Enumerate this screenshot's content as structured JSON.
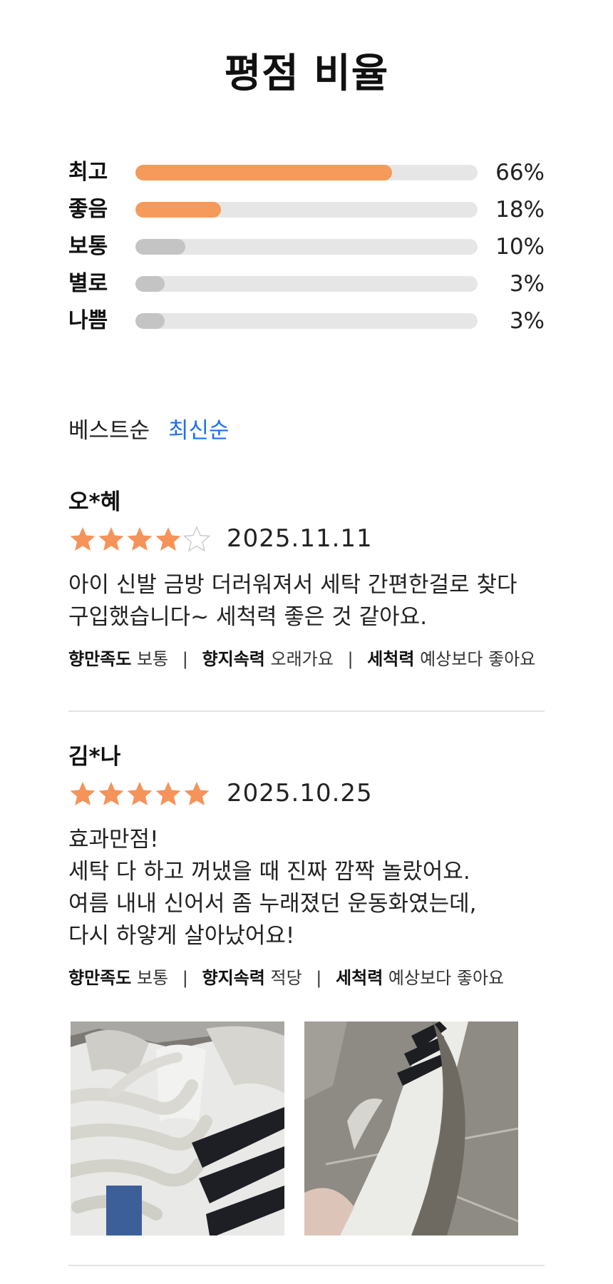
{
  "page": {
    "title": "평점 비율"
  },
  "ratings": [
    {
      "label": "최고",
      "percent_text": "66%",
      "fill_fraction": 0.75,
      "color": "#f59a5a"
    },
    {
      "label": "좋음",
      "percent_text": "18%",
      "fill_fraction": 0.25,
      "color": "#f59a5a"
    },
    {
      "label": "보통",
      "percent_text": "10%",
      "fill_fraction": 0.145,
      "color": "#c4c4c4"
    },
    {
      "label": "별로",
      "percent_text": "3%",
      "fill_fraction": 0.085,
      "color": "#c4c4c4"
    },
    {
      "label": "나쁨",
      "percent_text": "3%",
      "fill_fraction": 0.085,
      "color": "#c4c4c4"
    }
  ],
  "sort": {
    "best": "베스트순",
    "latest": "최신순",
    "active": "latest"
  },
  "colors": {
    "star": "#f5935a",
    "star_empty": "#cccccc",
    "accent": "#1e6ff0"
  },
  "reviews": [
    {
      "author": "오*혜",
      "rating": 4,
      "date": "2025.11.11",
      "text": "아이 신발 금방 더러워져서 세탁 간편한걸로 찾다\n구입했습니다~ 세척력 좋은 것 같아요.",
      "attributes": [
        {
          "key": "향만족도",
          "value": "보통"
        },
        {
          "key": "향지속력",
          "value": "오래가요"
        },
        {
          "key": "세척력",
          "value": "예상보다 좋아요"
        }
      ]
    },
    {
      "author": "김*나",
      "rating": 5,
      "date": "2025.10.25",
      "text": "효과만점!\n세탁 다 하고 꺼냈을 때 진짜 깜짝 놀랐어요.\n여름 내내 신어서 좀 누래졌던 운동화였는데,\n다시 하얗게 살아났어요!",
      "attributes": [
        {
          "key": "향만족도",
          "value": "보통"
        },
        {
          "key": "향지속력",
          "value": "적당"
        },
        {
          "key": "세척력",
          "value": "예상보다 좋아요"
        }
      ],
      "photos": [
        {
          "name": "sneaker-laces-photo"
        },
        {
          "name": "sneaker-side-photo"
        }
      ]
    }
  ]
}
